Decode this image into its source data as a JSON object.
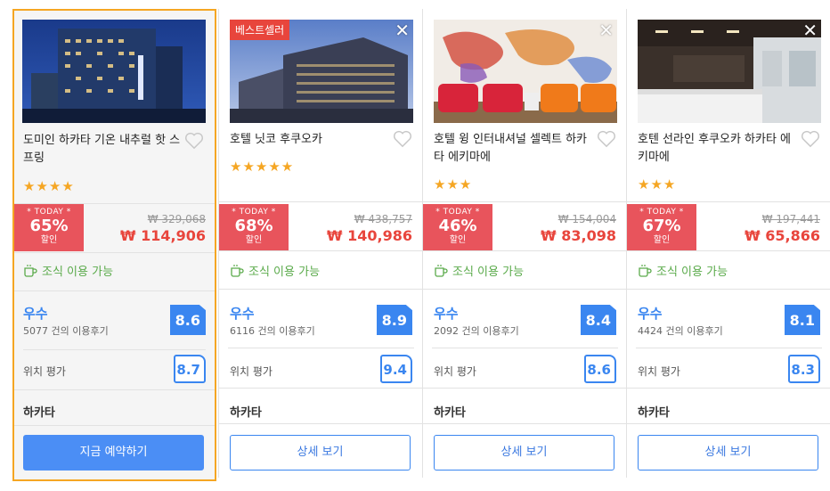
{
  "hotels": [
    {
      "name": "도미인 하카타 기온 내추럴 핫 스프링",
      "stars": "★★★★",
      "today_label": "* TODAY *",
      "discount": "65%",
      "discount_word": "할인",
      "original_price": "₩ 329,068",
      "price": "₩ 114,906",
      "breakfast": "조식 이용 가능",
      "grade": "우수",
      "reviews": "5077 건의 이용후기",
      "score": "8.6",
      "location_label": "위치 평가",
      "location_score": "8.7",
      "area": "하카타",
      "button": "지금 예약하기"
    },
    {
      "badge": "베스트셀러",
      "close": "✕",
      "name": "호텔 닛코 후쿠오카",
      "stars": "★★★★★",
      "today_label": "* TODAY *",
      "discount": "68%",
      "discount_word": "할인",
      "original_price": "₩ 438,757",
      "price": "₩ 140,986",
      "breakfast": "조식 이용 가능",
      "grade": "우수",
      "reviews": "6116 건의 이용후기",
      "score": "8.9",
      "location_label": "위치 평가",
      "location_score": "9.4",
      "area": "하카타",
      "button": "상세 보기"
    },
    {
      "close": "✕",
      "name": "호텔 윙 인터내셔널 셀렉트 하카타 에키마에",
      "stars": "★★★",
      "today_label": "* TODAY *",
      "discount": "46%",
      "discount_word": "할인",
      "original_price": "₩ 154,004",
      "price": "₩ 83,098",
      "breakfast": "조식 이용 가능",
      "grade": "우수",
      "reviews": "2092 건의 이용후기",
      "score": "8.4",
      "location_label": "위치 평가",
      "location_score": "8.6",
      "area": "하카타",
      "button": "상세 보기"
    },
    {
      "close": "✕",
      "name": "호텐 선라인 후쿠오카 하카타 에키마에",
      "stars": "★★★",
      "today_label": "* TODAY *",
      "discount": "67%",
      "discount_word": "할인",
      "original_price": "₩ 197,441",
      "price": "₩ 65,866",
      "breakfast": "조식 이용 가능",
      "grade": "우수",
      "reviews": "4424 건의 이용후기",
      "score": "8.1",
      "location_label": "위치 평가",
      "location_score": "8.3",
      "area": "하카타",
      "button": "상세 보기"
    }
  ],
  "colors": {
    "accent_blue": "#3a86f0",
    "discount_red": "#e8545c",
    "price_red": "#e8453c",
    "breakfast_green": "#5aaa4a",
    "star_orange": "#f5a623",
    "selected_border": "#f5a623"
  }
}
